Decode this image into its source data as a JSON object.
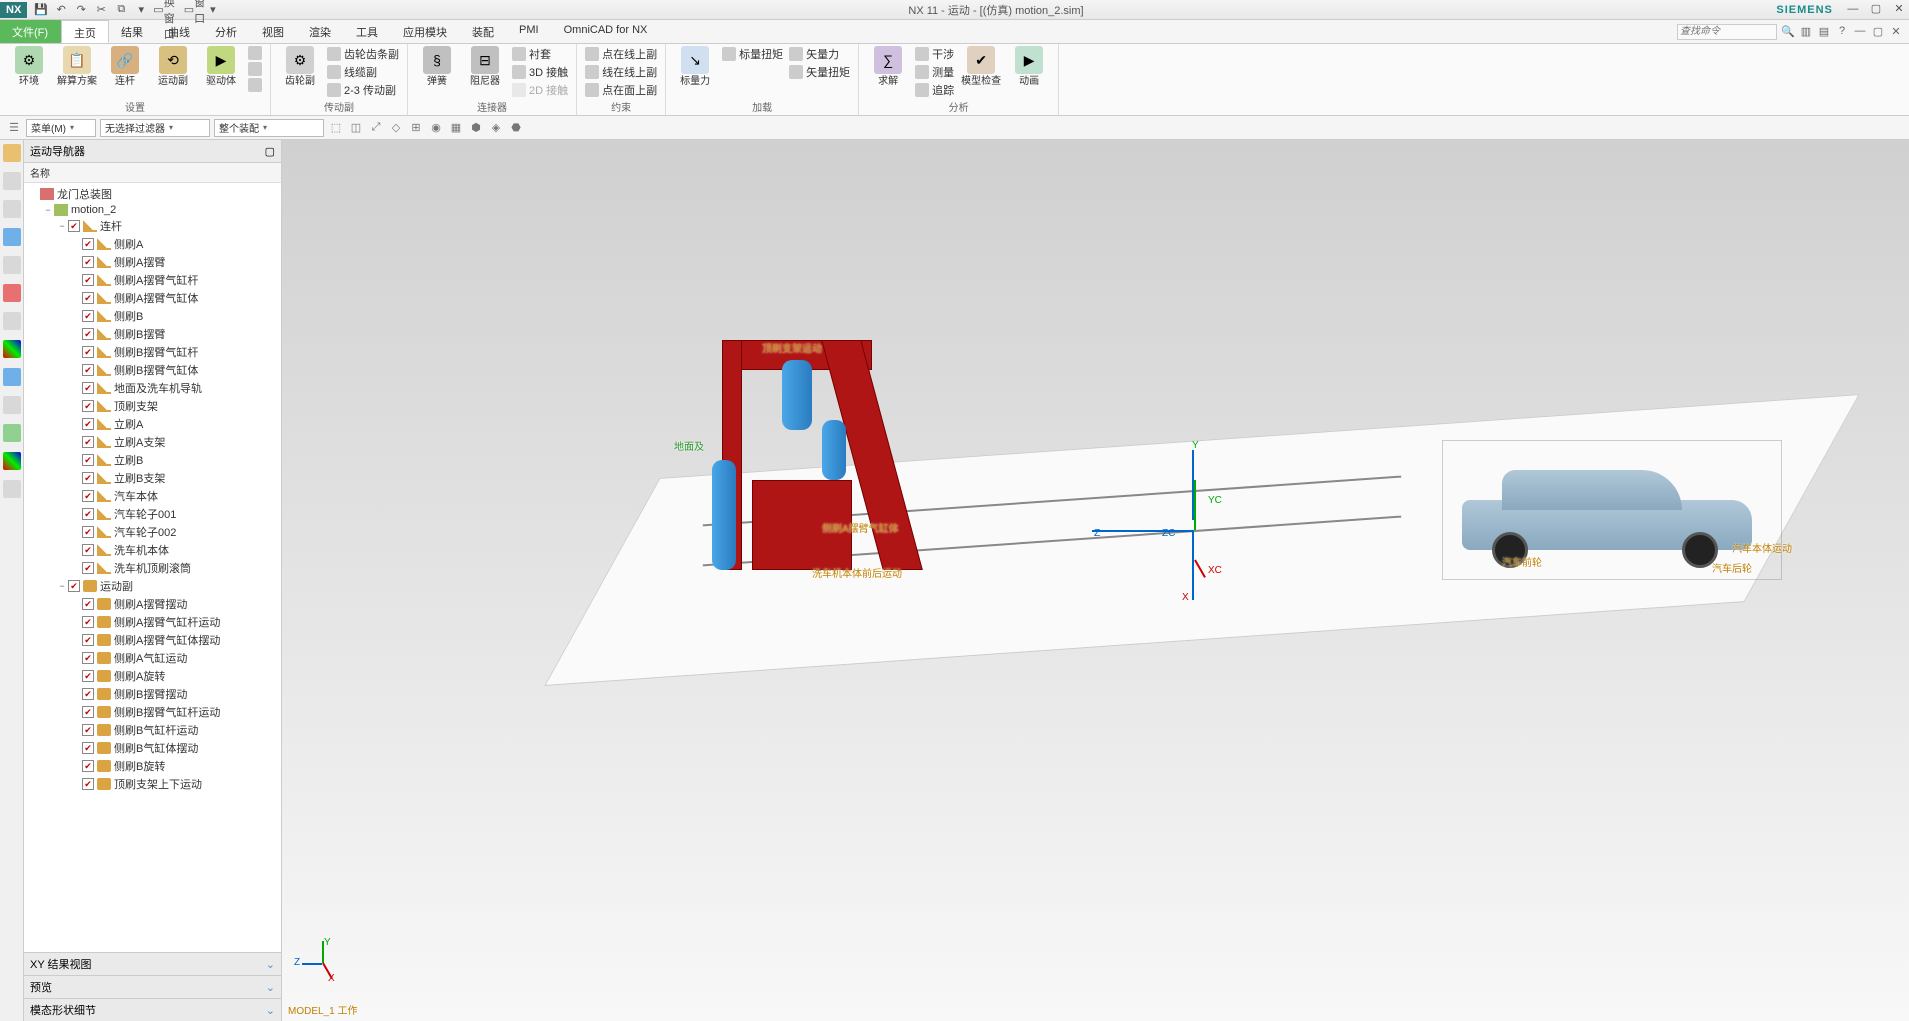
{
  "app": {
    "name": "NX",
    "title": "NX 11 - 运动 - [(仿真) motion_2.sim]",
    "brand": "SIEMENS"
  },
  "qat": {
    "switch_window": "切换窗口",
    "window": "窗口"
  },
  "tabs": {
    "file": "文件(F)",
    "list": [
      "主页",
      "结果",
      "曲线",
      "分析",
      "视图",
      "渲染",
      "工具",
      "应用模块",
      "装配",
      "PMI",
      "OmniCAD for NX"
    ],
    "active": 0,
    "search_placeholder": "查找命令"
  },
  "ribbon": {
    "groups": [
      {
        "name": "设置",
        "big": [
          "环境",
          "解算方案",
          "连杆",
          "运动副",
          "驱动体"
        ],
        "small": []
      },
      {
        "name": "",
        "big": [],
        "small": [
          [
            "",
            ""
          ],
          [
            "",
            ""
          ]
        ]
      },
      {
        "name": "传动副",
        "big": [
          "齿轮副"
        ],
        "small": [
          "齿轮齿条副",
          "线缆副",
          "2-3 传动副"
        ]
      },
      {
        "name": "连接器",
        "big": [
          "弹簧",
          "阻尼器"
        ],
        "small": [
          "衬套",
          "3D 接触",
          "2D 接触"
        ]
      },
      {
        "name": "约束",
        "big": [],
        "small": [
          "点在线上副",
          "线在线上副",
          "点在面上副"
        ]
      },
      {
        "name": "加载",
        "big": [
          "标量力"
        ],
        "small_left": [
          "标量扭矩"
        ],
        "small": [
          "矢量力",
          "矢量扭矩"
        ]
      },
      {
        "name": "分析",
        "big": [
          "求解",
          "模型检查",
          "动画"
        ],
        "small": [
          "干涉",
          "测量",
          "追踪"
        ]
      }
    ]
  },
  "filterbar": {
    "menu": "菜单(M)",
    "combo1": "无选择过滤器",
    "combo2": "整个装配"
  },
  "navigator": {
    "title": "运动导航器",
    "header": "名称",
    "root": "龙门总装图",
    "motion": "motion_2",
    "links_group": "连杆",
    "links": [
      "侧刷A",
      "侧刷A摆臂",
      "侧刷A摆臂气缸杆",
      "侧刷A摆臂气缸体",
      "侧刷B",
      "侧刷B摆臂",
      "侧刷B摆臂气缸杆",
      "侧刷B摆臂气缸体",
      "地面及洗车机导轨",
      "顶刷支架",
      "立刷A",
      "立刷A支架",
      "立刷B",
      "立刷B支架",
      "汽车本体",
      "汽车轮子001",
      "汽车轮子002",
      "洗车机本体",
      "洗车机顶刷滚筒"
    ],
    "joints_group": "运动副",
    "joints": [
      "侧刷A摆臂摆动",
      "侧刷A摆臂气缸杆运动",
      "侧刷A摆臂气缸体摆动",
      "侧刷A气缸运动",
      "侧刷A旋转",
      "侧刷B摆臂摆动",
      "侧刷B摆臂气缸杆运动",
      "侧刷B气缸杆运动",
      "侧刷B气缸体摆动",
      "侧刷B旋转",
      "顶刷支架上下运动"
    ],
    "bottom": [
      "XY 结果视图",
      "预览",
      "模态形状细节"
    ]
  },
  "viewport": {
    "annotations": {
      "a1": "顶刷支架运动",
      "a2": "地面及",
      "a3": "侧刷A摆臂气缸体",
      "a4": "洗车机本体前后运动",
      "a5": "汽车本体运动",
      "a6": "汽车后轮",
      "a7": "汽车前轮"
    },
    "triad": {
      "x": "XC",
      "y": "YC",
      "z": "ZC",
      "xs": "X",
      "ys": "Y",
      "zs": "Z"
    },
    "status": "MODEL_1 工作"
  }
}
